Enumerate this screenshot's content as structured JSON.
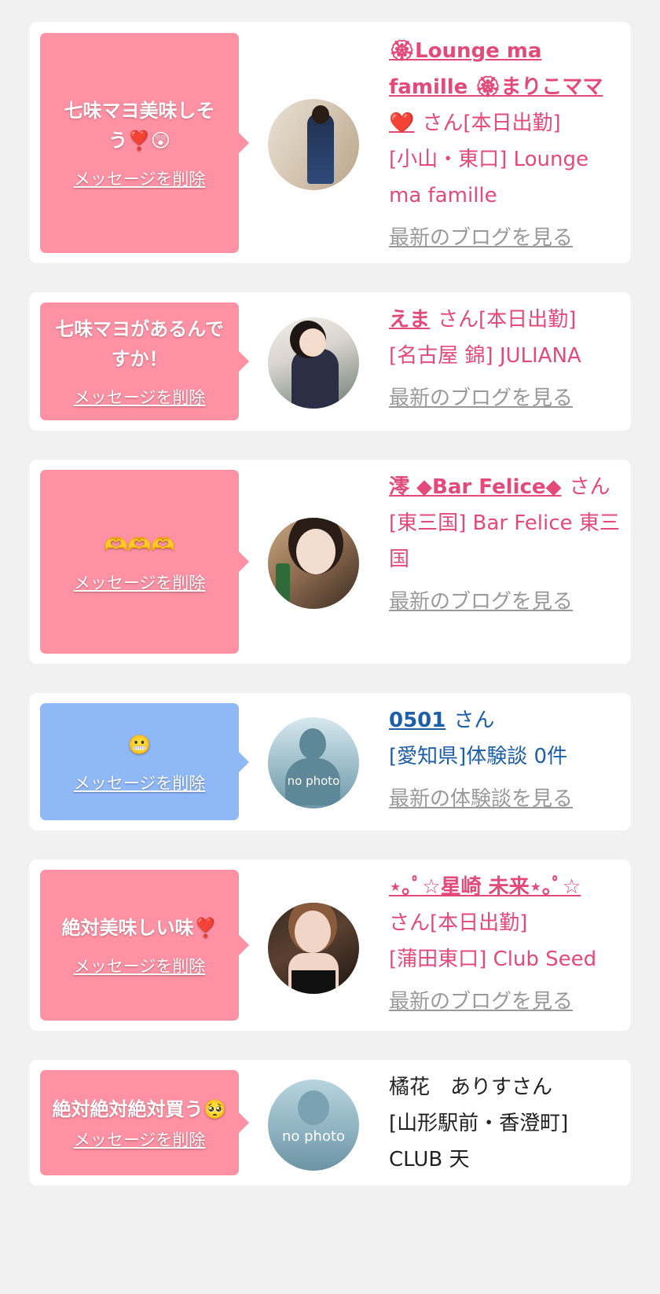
{
  "cards": [
    {
      "message": "七味マヨ美味しそう❣️😲",
      "delete_label": "メッセージを削除",
      "name": "🏵Lounge ma famille 🏵まりこママ❤️",
      "suffix": "さん[本日出勤]",
      "location": "[小山・東口] Lounge ma famille",
      "blog_link": "最新のブログを見る",
      "avatar": "photo-woman-kimono"
    },
    {
      "message": "七味マヨがあるんですか！",
      "delete_label": "メッセージを削除",
      "name": "えま",
      "suffix": "さん[本日出勤]",
      "location": "[名古屋 錦] JULIANA",
      "blog_link": "最新のブログを見る",
      "avatar": "photo-woman-lace"
    },
    {
      "message": "🫶🫶🫶",
      "delete_label": "メッセージを削除",
      "name": "澪 ◆Bar Felice◆",
      "suffix": "さん",
      "location": "[東三国] Bar Felice 東三国",
      "blog_link": "最新のブログを見る",
      "avatar": "photo-woman-bottle"
    },
    {
      "message": "😬",
      "delete_label": "メッセージを削除",
      "name": "0501",
      "suffix": "さん",
      "location": "[愛知県]体験談 0件",
      "blog_link": "最新の体験談を見る",
      "avatar": "no photo"
    },
    {
      "message": "絶対美味しい味❣️",
      "delete_label": "メッセージを削除",
      "name": "⋆｡ﾟ☆星崎 未来⋆｡ﾟ☆",
      "suffix": "さん[本日出勤]",
      "location": "[蒲田東口] Club Seed",
      "blog_link": "最新のブログを見る",
      "avatar": "photo-woman-bar"
    },
    {
      "message": "絶対絶対絶対買う🥺",
      "delete_label": "メッセージを削除",
      "name": "橘花　ありすさん",
      "suffix": "",
      "location": "[山形駅前・香澄町] CLUB 天",
      "blog_link": "",
      "avatar": "no photo"
    }
  ],
  "colors": {
    "bubble_pink": "#ff91a4",
    "bubble_blue": "#8fb8f7",
    "cast_text": "#e34a7a",
    "user_text": "#1c5ea8",
    "link_gray": "#999999"
  }
}
